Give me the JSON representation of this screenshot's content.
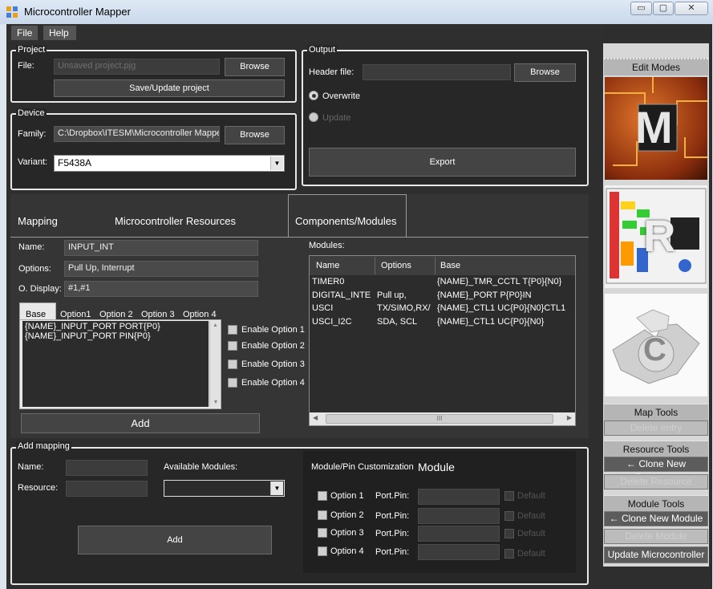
{
  "window": {
    "title": "Microcontroller Mapper",
    "min": "▭",
    "max": "▢",
    "close": "✕"
  },
  "menu": {
    "file": "File",
    "help": "Help"
  },
  "project": {
    "title": "Project",
    "file_label": "File:",
    "file_value": "Unsaved project.pjg",
    "browse": "Browse",
    "save": "Save/Update project"
  },
  "device": {
    "title": "Device",
    "family_label": "Family:",
    "family_value": "C:\\Dropbox\\ITESM\\Microcontroller Mappe",
    "browse": "Browse",
    "variant_label": "Variant:",
    "variant_value": "F5438A"
  },
  "output": {
    "title": "Output",
    "header_label": "Header file:",
    "header_value": "",
    "browse": "Browse",
    "overwrite": "Overwrite",
    "update": "Update",
    "export": "Export"
  },
  "tabs": {
    "mapping": "Mapping",
    "resources": "Microcontroller Resources",
    "components": "Components/Modules"
  },
  "resource": {
    "name_label": "Name:",
    "name_value": "INPUT_INT",
    "options_label": "Options:",
    "options_value": "Pull Up, Interrupt",
    "odisplay_label": "O. Display:",
    "odisplay_value": "#1,#1",
    "subtabs": [
      "Base",
      "Option1",
      "Option 2",
      "Option 3",
      "Option 4"
    ],
    "code_lines": [
      "{NAME}_INPUT_PORT PORT{P0}",
      "{NAME}_INPUT_PORT PIN{P0}"
    ],
    "enable": [
      "Enable Option 1",
      "Enable Option 2",
      "Enable Option 3",
      "Enable Option 4"
    ],
    "add": "Add"
  },
  "modules": {
    "label": "Modules:",
    "columns": [
      "Name",
      "Options",
      "Base"
    ],
    "rows": [
      {
        "name": "TIMER0",
        "options": "",
        "base": "{NAME}_TMR_CCTL    T{P0}{N0}"
      },
      {
        "name": "DIGITAL_INTE",
        "options": "Pull up,",
        "base": "{NAME}_PORT    P{P0}IN"
      },
      {
        "name": "USCI",
        "options": "TX/SIMO,RX/",
        "base": "{NAME}_CTL1    UC{P0}{N0}CTL1"
      },
      {
        "name": "USCI_I2C",
        "options": "SDA, SCL",
        "base": "{NAME}_CTL1      UC{P0}{N0}"
      }
    ],
    "scroll_grip": "III"
  },
  "add_mapping": {
    "title": "Add mapping",
    "name_label": "Name:",
    "resource_label": "Resource:",
    "avail_label": "Available Modules:",
    "add": "Add",
    "custom_title": "Module/Pin Customization",
    "module_title": "Module",
    "options": [
      "Option 1",
      "Option 2",
      "Option 3",
      "Option 4"
    ],
    "portpin": "Port.Pin:",
    "default": "Default"
  },
  "side": {
    "edit_modes": "Edit Modes",
    "map_tools": "Map Tools",
    "delete_entry": "Delete entry",
    "resource_tools": "Resource Tools",
    "clone_resource": "← Clone New Resource",
    "delete_resource": "Delete Resource",
    "module_tools": "Module Tools",
    "clone_module": "← Clone New Module",
    "delete_module": "Delete Module",
    "update": "Update Microcontroller",
    "letter_m": "M",
    "letter_r": "R",
    "letter_c": "C"
  }
}
